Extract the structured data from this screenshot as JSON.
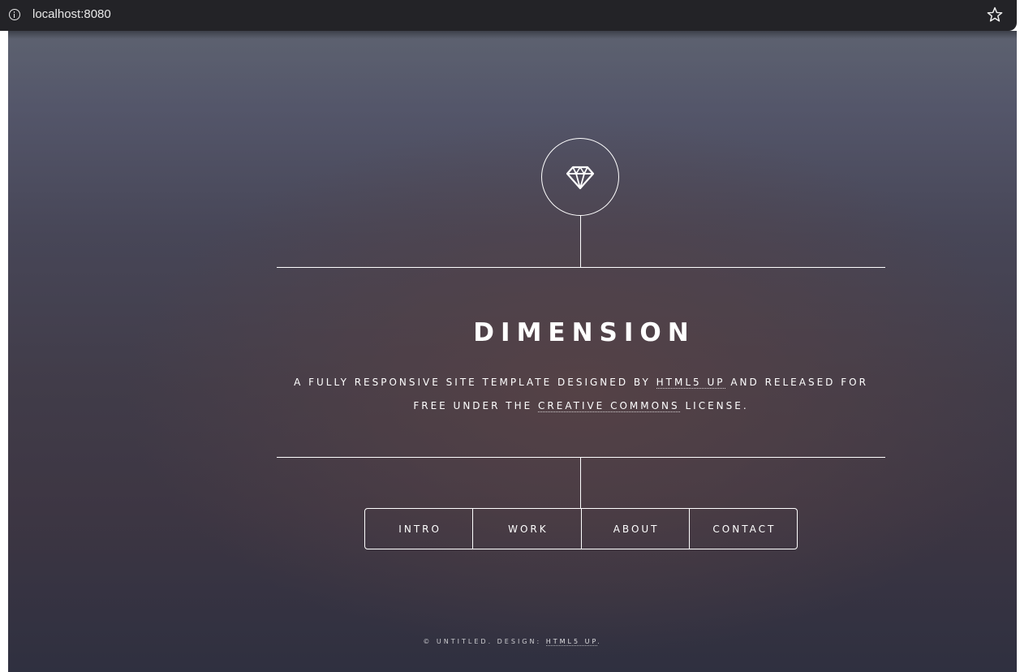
{
  "browser": {
    "address": "localhost:8080",
    "info_icon": "info-icon",
    "bookmark_icon": "star-icon"
  },
  "header": {
    "logo_icon": "diamond-icon",
    "title": "DIMENSION",
    "subtitle_part1": "A FULLY RESPONSIVE SITE TEMPLATE DESIGNED BY ",
    "subtitle_link1": "HTML5 UP",
    "subtitle_part2": " AND RELEASED FOR FREE UNDER THE ",
    "subtitle_link2": "CREATIVE COMMONS",
    "subtitle_part3": " LICENSE."
  },
  "nav": {
    "items": [
      {
        "label": "INTRO"
      },
      {
        "label": "WORK"
      },
      {
        "label": "ABOUT"
      },
      {
        "label": "CONTACT"
      }
    ]
  },
  "footer": {
    "text": "© UNTITLED. DESIGN: ",
    "link": "HTML5 UP",
    "end": "."
  },
  "colors": {
    "browser_bar": "#232327",
    "line_color": "#ffffff",
    "text_color": "#ffffff"
  }
}
